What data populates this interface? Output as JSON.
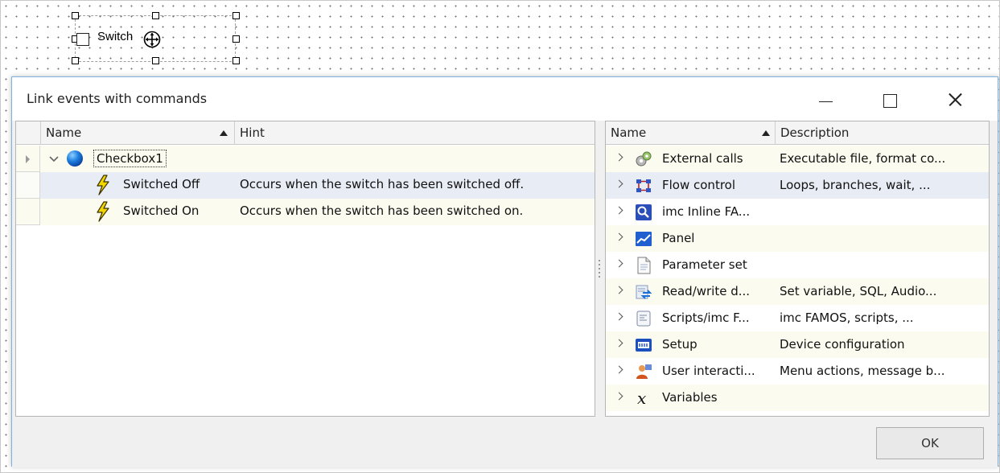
{
  "designer": {
    "switch_label": "Switch"
  },
  "dialog": {
    "title": "Link events with commands",
    "ok_label": "OK"
  },
  "events_grid": {
    "columns": [
      "Name",
      "Hint"
    ],
    "rows": [
      {
        "name": "Checkbox1",
        "hint": ""
      },
      {
        "name": "Switched Off",
        "hint": "Occurs when the switch has been switched off."
      },
      {
        "name": "Switched On",
        "hint": "Occurs when the switch has been switched on."
      }
    ]
  },
  "commands_grid": {
    "columns": [
      "Name",
      "Description"
    ],
    "rows": [
      {
        "name": "External calls",
        "description": "Executable file, format co...",
        "icon": "gears-icon"
      },
      {
        "name": "Flow control",
        "description": "Loops, branches, wait, ...",
        "icon": "flow-control-icon"
      },
      {
        "name": "imc Inline FA...",
        "description": "",
        "icon": "inline-famos-icon"
      },
      {
        "name": "Panel",
        "description": "",
        "icon": "panel-chart-icon"
      },
      {
        "name": "Parameter set",
        "description": "",
        "icon": "document-icon"
      },
      {
        "name": "Read/write d...",
        "description": "Set variable, SQL, Audio...",
        "icon": "read-write-icon"
      },
      {
        "name": "Scripts/imc F...",
        "description": "imc FAMOS, scripts, ...",
        "icon": "script-icon"
      },
      {
        "name": "Setup",
        "description": "Device configuration",
        "icon": "setup-icon"
      },
      {
        "name": "User interacti...",
        "description": "Menu actions, message b...",
        "icon": "user-icon"
      },
      {
        "name": "Variables",
        "description": "",
        "icon": "variable-x-icon"
      }
    ]
  },
  "colors": {
    "row_alt": "#fbfbf0",
    "selected_row": "#e8ecf4",
    "dialog_border": "#7fb2de",
    "lightning": "#e6c800"
  }
}
